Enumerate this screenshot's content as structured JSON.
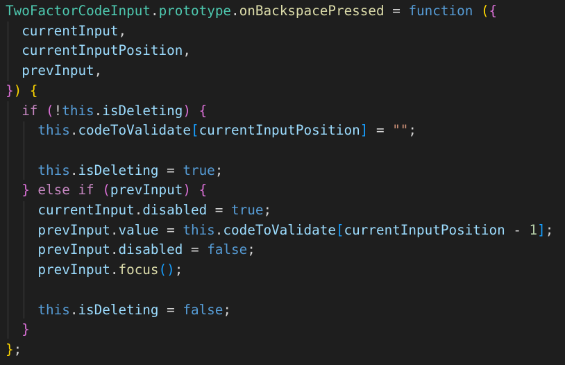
{
  "editor": {
    "background": "#1e1e1e",
    "lines": [
      {
        "indent": 0,
        "tokens": [
          {
            "text": "TwoFactorCodeInput",
            "color": "#4ec9b0"
          },
          {
            "text": ".",
            "color": "#d4d4d4"
          },
          {
            "text": "prototype",
            "color": "#4ec9b0"
          },
          {
            "text": ".",
            "color": "#d4d4d4"
          },
          {
            "text": "onBackspacePressed",
            "color": "#dcdcaa"
          },
          {
            "text": " = ",
            "color": "#d4d4d4"
          },
          {
            "text": "function",
            "color": "#569cd6"
          },
          {
            "text": " ",
            "color": "#d4d4d4"
          },
          {
            "text": "(",
            "color": "#ffd700"
          },
          {
            "text": "{",
            "color": "#da70d6"
          }
        ]
      },
      {
        "indent": 1,
        "tokens": [
          {
            "text": "currentInput",
            "color": "#9cdcfe"
          },
          {
            "text": ",",
            "color": "#d4d4d4"
          }
        ]
      },
      {
        "indent": 1,
        "tokens": [
          {
            "text": "currentInputPosition",
            "color": "#9cdcfe"
          },
          {
            "text": ",",
            "color": "#d4d4d4"
          }
        ]
      },
      {
        "indent": 1,
        "tokens": [
          {
            "text": "prevInput",
            "color": "#9cdcfe"
          },
          {
            "text": ",",
            "color": "#d4d4d4"
          }
        ]
      },
      {
        "indent": 0,
        "tokens": [
          {
            "text": "}",
            "color": "#da70d6"
          },
          {
            "text": ")",
            "color": "#ffd700"
          },
          {
            "text": " ",
            "color": "#d4d4d4"
          },
          {
            "text": "{",
            "color": "#ffd700"
          }
        ]
      },
      {
        "indent": 1,
        "tokens": [
          {
            "text": "if",
            "color": "#c586c0"
          },
          {
            "text": " ",
            "color": "#d4d4d4"
          },
          {
            "text": "(",
            "color": "#da70d6"
          },
          {
            "text": "!",
            "color": "#d4d4d4"
          },
          {
            "text": "this",
            "color": "#569cd6"
          },
          {
            "text": ".",
            "color": "#d4d4d4"
          },
          {
            "text": "isDeleting",
            "color": "#9cdcfe"
          },
          {
            "text": ")",
            "color": "#da70d6"
          },
          {
            "text": " ",
            "color": "#d4d4d4"
          },
          {
            "text": "{",
            "color": "#da70d6"
          }
        ]
      },
      {
        "indent": 2,
        "tokens": [
          {
            "text": "this",
            "color": "#569cd6"
          },
          {
            "text": ".",
            "color": "#d4d4d4"
          },
          {
            "text": "codeToValidate",
            "color": "#9cdcfe"
          },
          {
            "text": "[",
            "color": "#179fff"
          },
          {
            "text": "currentInputPosition",
            "color": "#9cdcfe"
          },
          {
            "text": "]",
            "color": "#179fff"
          },
          {
            "text": " = ",
            "color": "#d4d4d4"
          },
          {
            "text": "\"\"",
            "color": "#ce9178"
          },
          {
            "text": ";",
            "color": "#d4d4d4"
          }
        ]
      },
      {
        "indent": 2,
        "tokens": []
      },
      {
        "indent": 2,
        "tokens": [
          {
            "text": "this",
            "color": "#569cd6"
          },
          {
            "text": ".",
            "color": "#d4d4d4"
          },
          {
            "text": "isDeleting",
            "color": "#9cdcfe"
          },
          {
            "text": " = ",
            "color": "#d4d4d4"
          },
          {
            "text": "true",
            "color": "#569cd6"
          },
          {
            "text": ";",
            "color": "#d4d4d4"
          }
        ]
      },
      {
        "indent": 1,
        "tokens": [
          {
            "text": "}",
            "color": "#da70d6"
          },
          {
            "text": " ",
            "color": "#d4d4d4"
          },
          {
            "text": "else",
            "color": "#c586c0"
          },
          {
            "text": " ",
            "color": "#d4d4d4"
          },
          {
            "text": "if",
            "color": "#c586c0"
          },
          {
            "text": " ",
            "color": "#d4d4d4"
          },
          {
            "text": "(",
            "color": "#da70d6"
          },
          {
            "text": "prevInput",
            "color": "#9cdcfe"
          },
          {
            "text": ")",
            "color": "#da70d6"
          },
          {
            "text": " ",
            "color": "#d4d4d4"
          },
          {
            "text": "{",
            "color": "#da70d6"
          }
        ]
      },
      {
        "indent": 2,
        "tokens": [
          {
            "text": "currentInput",
            "color": "#9cdcfe"
          },
          {
            "text": ".",
            "color": "#d4d4d4"
          },
          {
            "text": "disabled",
            "color": "#9cdcfe"
          },
          {
            "text": " = ",
            "color": "#d4d4d4"
          },
          {
            "text": "true",
            "color": "#569cd6"
          },
          {
            "text": ";",
            "color": "#d4d4d4"
          }
        ]
      },
      {
        "indent": 2,
        "tokens": [
          {
            "text": "prevInput",
            "color": "#9cdcfe"
          },
          {
            "text": ".",
            "color": "#d4d4d4"
          },
          {
            "text": "value",
            "color": "#9cdcfe"
          },
          {
            "text": " = ",
            "color": "#d4d4d4"
          },
          {
            "text": "this",
            "color": "#569cd6"
          },
          {
            "text": ".",
            "color": "#d4d4d4"
          },
          {
            "text": "codeToValidate",
            "color": "#9cdcfe"
          },
          {
            "text": "[",
            "color": "#179fff"
          },
          {
            "text": "currentInputPosition",
            "color": "#9cdcfe"
          },
          {
            "text": " - ",
            "color": "#d4d4d4"
          },
          {
            "text": "1",
            "color": "#b5cea8"
          },
          {
            "text": "]",
            "color": "#179fff"
          },
          {
            "text": ";",
            "color": "#d4d4d4"
          }
        ]
      },
      {
        "indent": 2,
        "tokens": [
          {
            "text": "prevInput",
            "color": "#9cdcfe"
          },
          {
            "text": ".",
            "color": "#d4d4d4"
          },
          {
            "text": "disabled",
            "color": "#9cdcfe"
          },
          {
            "text": " = ",
            "color": "#d4d4d4"
          },
          {
            "text": "false",
            "color": "#569cd6"
          },
          {
            "text": ";",
            "color": "#d4d4d4"
          }
        ]
      },
      {
        "indent": 2,
        "tokens": [
          {
            "text": "prevInput",
            "color": "#9cdcfe"
          },
          {
            "text": ".",
            "color": "#d4d4d4"
          },
          {
            "text": "focus",
            "color": "#dcdcaa"
          },
          {
            "text": "()",
            "color": "#179fff"
          },
          {
            "text": ";",
            "color": "#d4d4d4"
          }
        ]
      },
      {
        "indent": 2,
        "tokens": []
      },
      {
        "indent": 2,
        "tokens": [
          {
            "text": "this",
            "color": "#569cd6"
          },
          {
            "text": ".",
            "color": "#d4d4d4"
          },
          {
            "text": "isDeleting",
            "color": "#9cdcfe"
          },
          {
            "text": " = ",
            "color": "#d4d4d4"
          },
          {
            "text": "false",
            "color": "#569cd6"
          },
          {
            "text": ";",
            "color": "#d4d4d4"
          }
        ]
      },
      {
        "indent": 1,
        "tokens": [
          {
            "text": "}",
            "color": "#da70d6"
          }
        ]
      },
      {
        "indent": 0,
        "tokens": [
          {
            "text": "}",
            "color": "#ffd700"
          },
          {
            "text": ";",
            "color": "#d4d4d4"
          }
        ]
      }
    ]
  }
}
